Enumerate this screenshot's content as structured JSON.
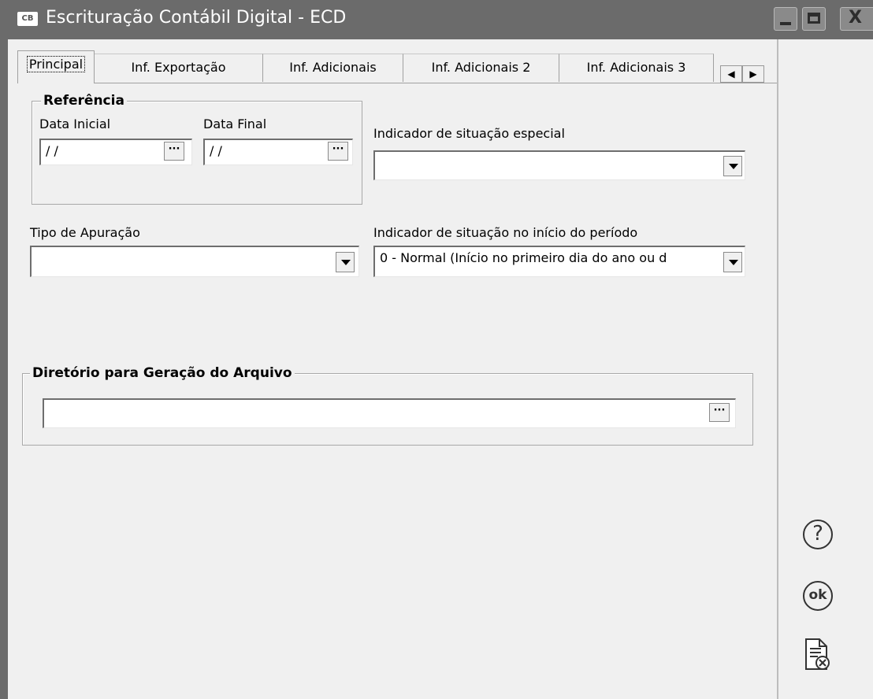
{
  "window": {
    "badge": "CB",
    "title": "Escrituração Contábil Digital - ECD",
    "controls": {
      "minimize": "minimize",
      "maximize": "maximize",
      "close": "X"
    }
  },
  "tabs": [
    {
      "label": "Principal",
      "active": true
    },
    {
      "label": "Inf. Exportação",
      "active": false
    },
    {
      "label": "Inf. Adicionais",
      "active": false
    },
    {
      "label": "Inf. Adicionais 2",
      "active": false
    },
    {
      "label": "Inf. Adicionais 3",
      "active": false
    }
  ],
  "tab_scroll": {
    "left": "◀",
    "right": "▶"
  },
  "referencia": {
    "title": "Referência",
    "data_inicial": {
      "label": "Data Inicial",
      "value": " / /"
    },
    "data_final": {
      "label": "Data Final",
      "value": " / /"
    },
    "browse": "···"
  },
  "situacao_especial": {
    "label": "Indicador de situação especial",
    "value": ""
  },
  "tipo_apuracao": {
    "label": "Tipo de Apuração",
    "value": ""
  },
  "situacao_inicio": {
    "label": "Indicador de situação no início do período",
    "value": "0 - Normal (Início no primeiro dia do ano ou d"
  },
  "diretorio": {
    "title": "Diretório para Geração do Arquivo",
    "value": "",
    "browse": "···"
  },
  "side": {
    "help": "?",
    "ok": "ok",
    "cancel_icon": "cancel-document-icon"
  }
}
